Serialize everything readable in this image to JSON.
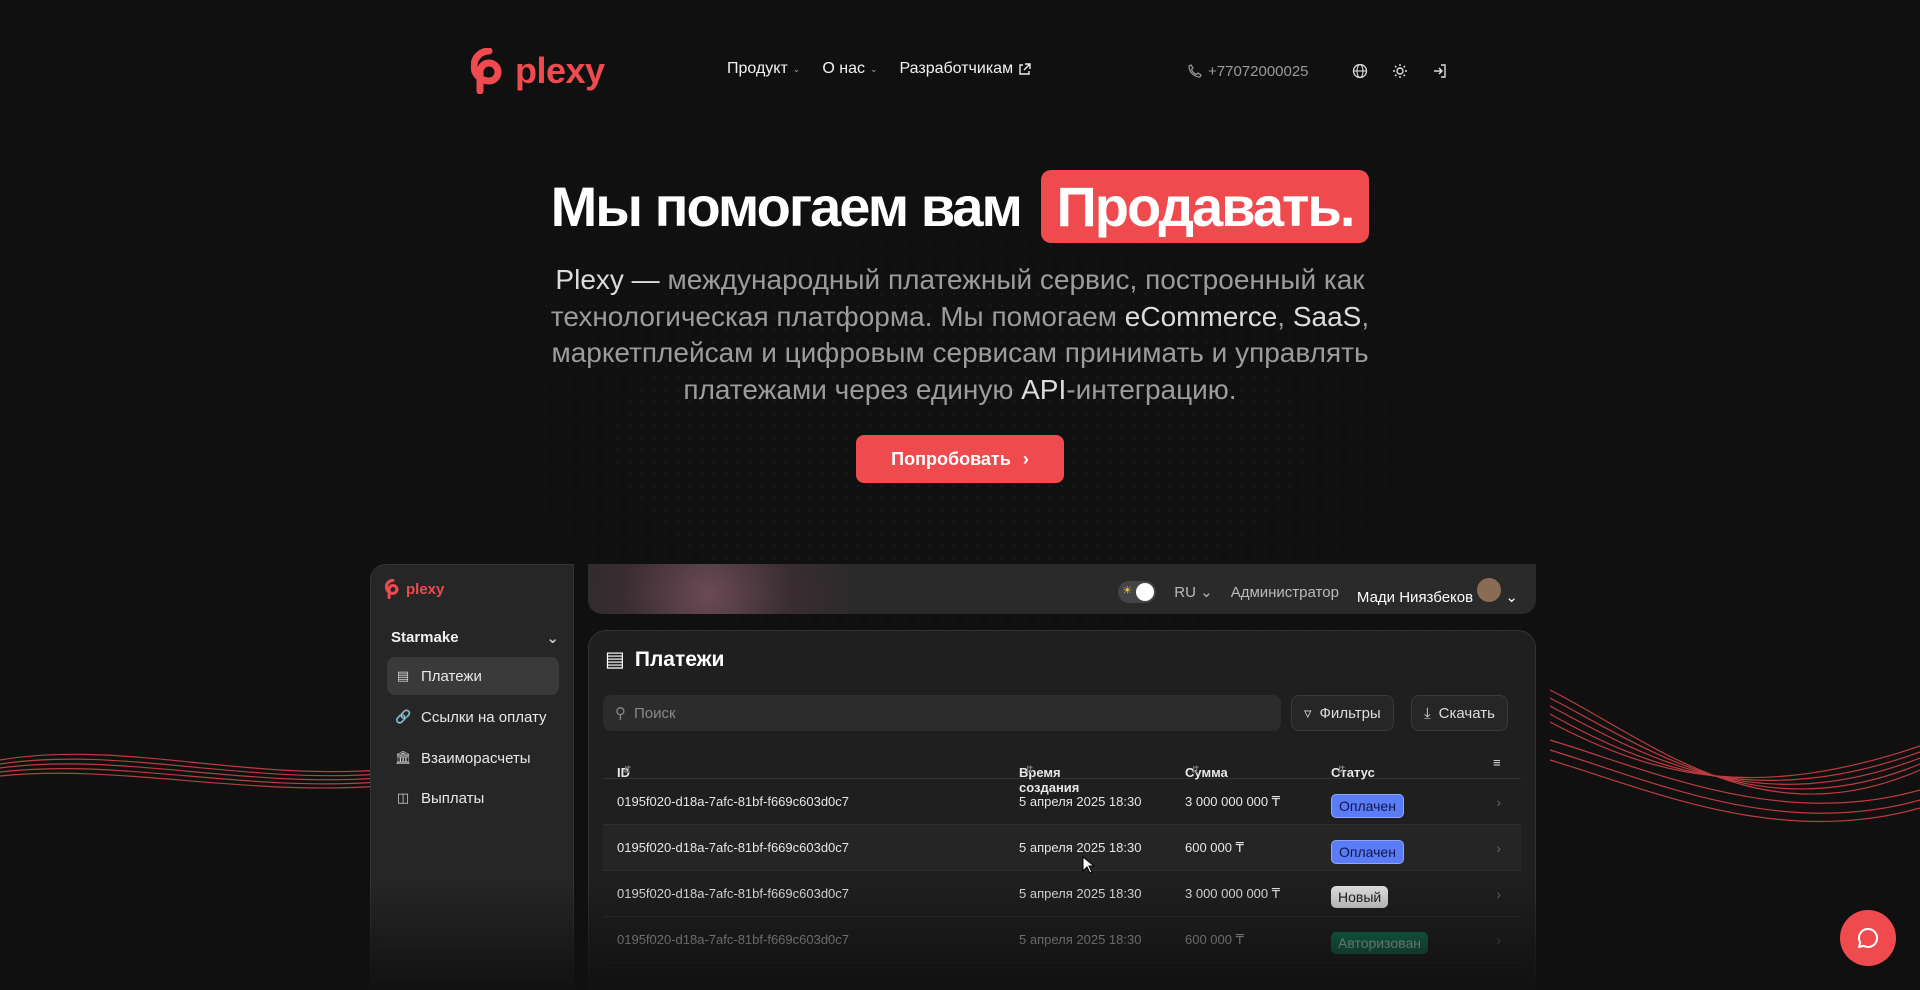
{
  "header": {
    "logo_text": "plexy",
    "nav": [
      {
        "label": "Продукт",
        "icon": "chevron-down-icon"
      },
      {
        "label": "О нас",
        "icon": "chevron-down-icon"
      },
      {
        "label": "Разработчикам",
        "icon": "external-link-icon"
      }
    ],
    "phone": "+77072000025",
    "brand_color": "#ef4b4f"
  },
  "hero": {
    "title_plain": "Мы помогаем вам",
    "title_highlight": "Продавать.",
    "desc_1": "Plexy —",
    "desc_2": " международный платежный сервис, построенный как технологическая платформа. Мы помогаем ",
    "desc_3": "eCommerce",
    "desc_4": ", ",
    "desc_5": "SaaS",
    "desc_6": ", маркетплейсам и цифровым сервисам принимать и управлять платежами через единую ",
    "desc_7": "API",
    "desc_8": "-интеграцию.",
    "cta_label": "Попробовать"
  },
  "app": {
    "logo_text": "plexy",
    "org_name": "Starmake",
    "sidebar": [
      {
        "label": "Платежи",
        "icon": "card-icon",
        "active": true
      },
      {
        "label": "Ссылки на оплату",
        "icon": "link-icon"
      },
      {
        "label": "Взаиморасчеты",
        "icon": "bank-icon"
      },
      {
        "label": "Выплаты",
        "icon": "payout-icon"
      }
    ],
    "topbar": {
      "lang": "RU",
      "role": "Администратор",
      "user_name": "Мади Ниязбеков"
    },
    "page_title": "Платежи",
    "search_placeholder": "Поиск",
    "filters_label": "Фильтры",
    "download_label": "Скачать",
    "columns": [
      "ID",
      "Время создания",
      "Сумма",
      "Статус"
    ],
    "rows": [
      {
        "id": "0195f020-d18a-7afc-81bf-f669c603d0c7",
        "time": "5 апреля 2025 18:30",
        "amount": "3 000 000 000 ₸",
        "status": "Оплачен"
      },
      {
        "id": "0195f020-d18a-7afc-81bf-f669c603d0c7",
        "time": "5 апреля 2025 18:30",
        "amount": "600 000 ₸",
        "status": "Оплачен"
      },
      {
        "id": "0195f020-d18a-7afc-81bf-f669c603d0c7",
        "time": "5 апреля 2025 18:30",
        "amount": "3 000 000 000 ₸",
        "status": "Новый"
      },
      {
        "id": "0195f020-d18a-7afc-81bf-f669c603d0c7",
        "time": "5 апреля 2025 18:30",
        "amount": "600 000 ₸",
        "status": "Авторизован"
      }
    ],
    "status_colors": {
      "paid": "#5b7cf7",
      "new": "#e6e6e6",
      "authorized": "#11805a"
    }
  }
}
